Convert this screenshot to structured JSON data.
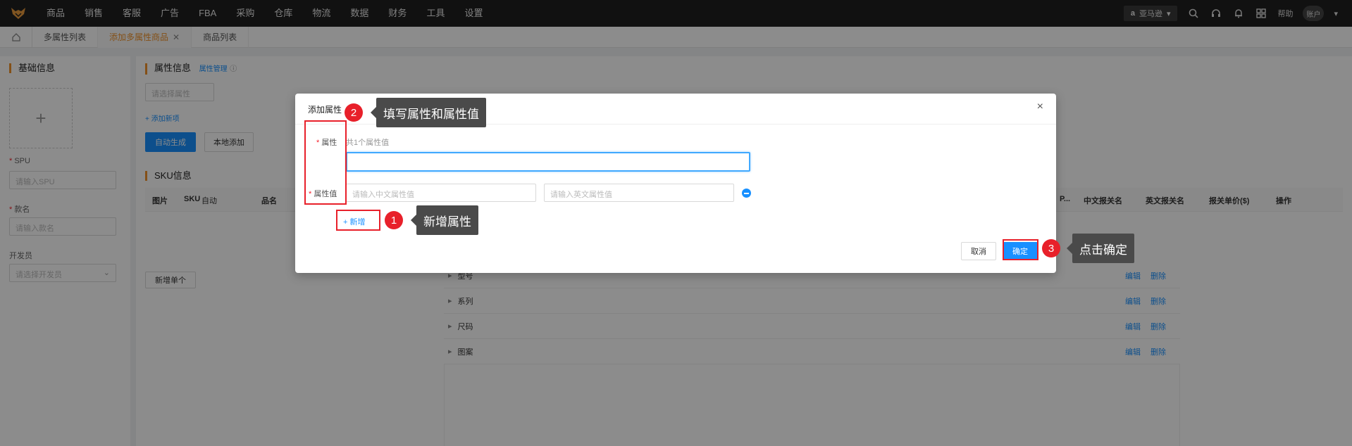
{
  "nav": {
    "items": [
      "商品",
      "销售",
      "客服",
      "广告",
      "FBA",
      "采购",
      "仓库",
      "物流",
      "数据",
      "财务",
      "工具",
      "设置"
    ],
    "store": "亚马逊",
    "help": "帮助",
    "account": "账户"
  },
  "tabs": {
    "items": [
      {
        "label": "多属性列表"
      },
      {
        "label": "添加多属性商品"
      },
      {
        "label": "商品列表"
      }
    ]
  },
  "left": {
    "title": "基础信息",
    "spu_label": "SPU",
    "spu_placeholder": "请输入SPU",
    "name_label": "款名",
    "name_placeholder": "请输入款名",
    "dev_label": "开发员",
    "dev_placeholder": "请选择开发员"
  },
  "main": {
    "attr_title": "属性信息",
    "attr_manage": "属性管理",
    "attr_select_placeholder": "请选择属性",
    "add_new": "+ 添加新项",
    "auto_gen": "自动生成",
    "local_add": "本地添加",
    "sku_title": "SKU信息",
    "columns": [
      "图片",
      "SKU",
      "自动",
      "品名",
      "P...",
      "中文报关名",
      "英文报关名",
      "报关单价($)",
      "操作"
    ],
    "add_single": "新增单个",
    "groups": [
      {
        "name": "型号",
        "edit": "编辑",
        "del": "删除"
      },
      {
        "name": "系列",
        "edit": "编辑",
        "del": "删除"
      },
      {
        "name": "尺码",
        "edit": "编辑",
        "del": "删除"
      },
      {
        "name": "图案",
        "edit": "编辑",
        "del": "删除"
      }
    ]
  },
  "modal": {
    "title": "添加属性",
    "attr_label": "属性",
    "attr_count": "共1个属性值",
    "value_label": "属性值",
    "cn_placeholder": "请输入中文属性值",
    "en_placeholder": "请输入英文属性值",
    "add_button": "+ 新增",
    "cancel": "取消",
    "ok": "确定"
  },
  "annotations": [
    {
      "num": "1",
      "text": "新增属性"
    },
    {
      "num": "2",
      "text": "填写属性和属性值"
    },
    {
      "num": "3",
      "text": "点击确定"
    }
  ],
  "colors": {
    "accent": "#1890ff",
    "brand": "#f0932b",
    "annotation": "#e8202a"
  }
}
